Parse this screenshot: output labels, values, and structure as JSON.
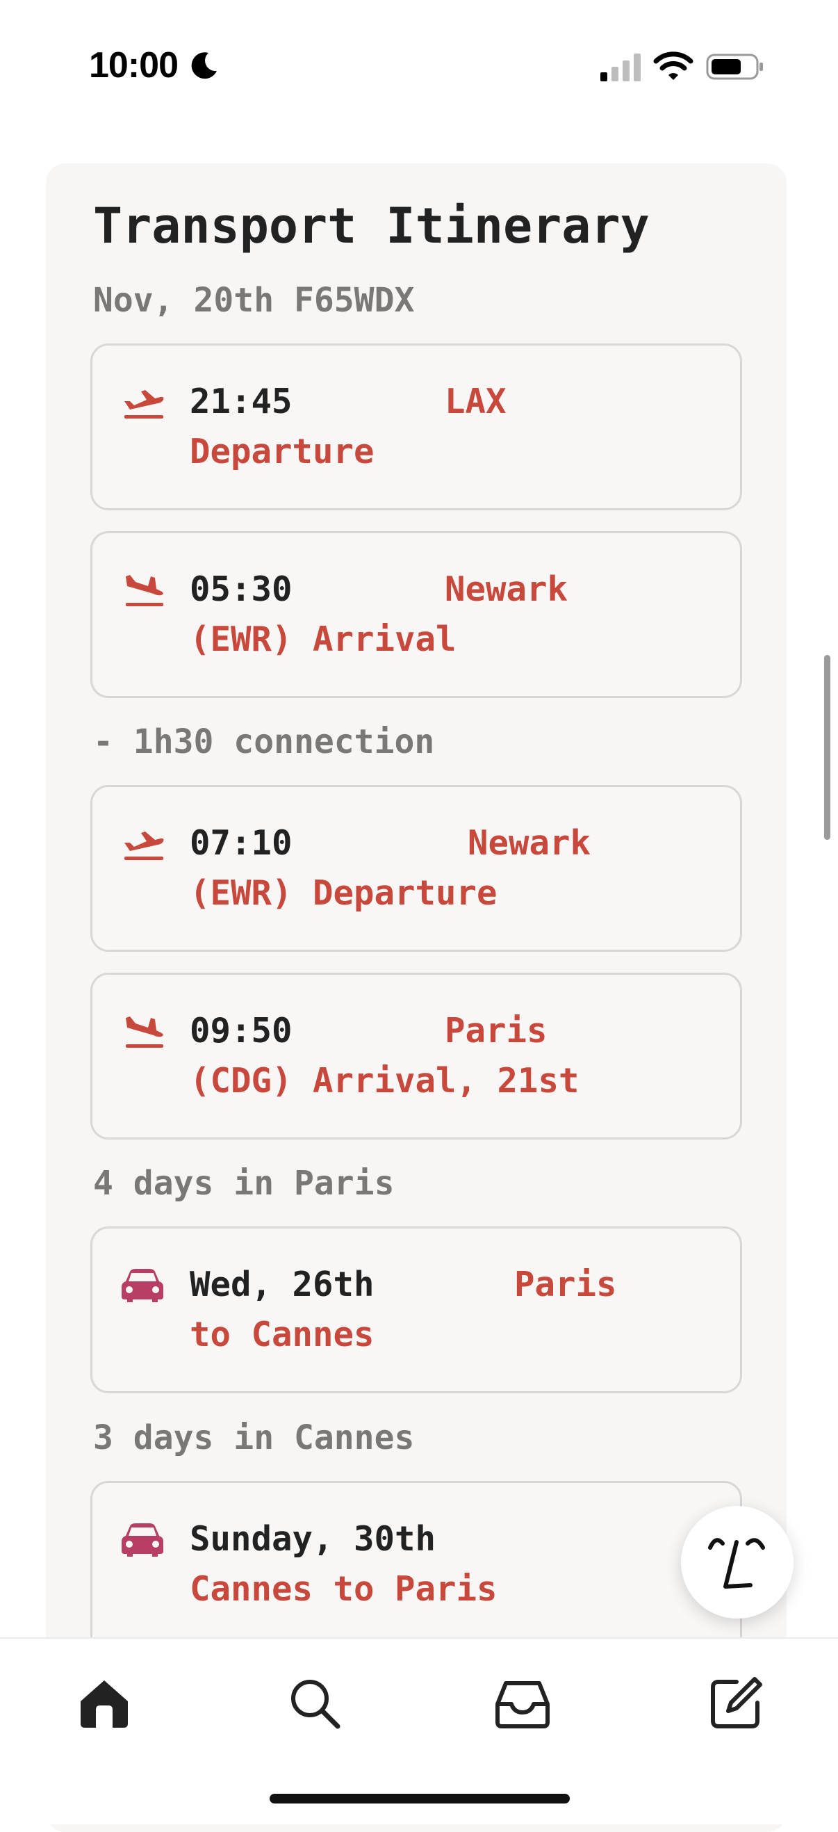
{
  "status_bar": {
    "time": "10:00",
    "icons": [
      "moon-icon",
      "cellular-signal-icon",
      "wifi-icon",
      "battery-icon"
    ]
  },
  "itinerary": {
    "title": "Transport Itinerary",
    "subtitle": "Nov, 20th F65WDX",
    "connection_note": "- 1h30 connection",
    "paris_stay_note": "4 days in Paris",
    "cannes_stay_note": "3 days in Cannes",
    "legs": [
      {
        "icon": "plane-departure-icon",
        "time": "21:45",
        "dest": "LAX",
        "detail": "Departure"
      },
      {
        "icon": "plane-arrival-icon",
        "time": "05:30",
        "dest": "Newark",
        "detail": "(EWR) Arrival"
      },
      {
        "icon": "plane-departure-icon",
        "time": "07:10",
        "dest": "Newark",
        "detail": "(EWR) Departure"
      },
      {
        "icon": "plane-arrival-icon",
        "time": "09:50",
        "dest": "Paris",
        "detail": "(CDG) Arrival, 21st"
      },
      {
        "icon": "car-icon",
        "time": "Wed, 26th",
        "dest": "Paris",
        "detail": "to Cannes"
      },
      {
        "icon": "car-icon",
        "time": "Sunday, 30th",
        "dest": "",
        "detail": "Cannes to Paris"
      }
    ]
  },
  "colors": {
    "accent_red": "#c8483c",
    "car_pink": "#b83e66",
    "card_bg": "#f7f6f5",
    "text_dark": "#222222",
    "text_muted": "#7a7776"
  },
  "tab_bar": {
    "tabs": [
      "home-icon",
      "search-icon",
      "inbox-icon",
      "compose-icon"
    ],
    "active": "home-icon"
  }
}
